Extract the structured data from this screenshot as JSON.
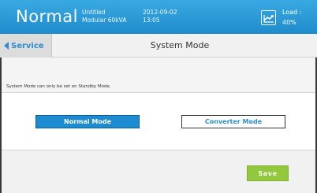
{
  "header": {
    "status": "Normal",
    "device_name": "Untitled",
    "device_model": "Modular 60kVA",
    "date": "2012-09-02",
    "time": "13:05",
    "load_label": "Load :",
    "load_value": "40%",
    "load_icon": "load-graph-icon"
  },
  "nav": {
    "back_label": "Service",
    "title": "System Mode"
  },
  "note": "System Mode can only be set on Standby Mode.",
  "modes": {
    "normal_label": "Normal Mode",
    "converter_label": "Converter Mode",
    "selected": "Normal Mode"
  },
  "actions": {
    "save_label": "Save"
  },
  "colors": {
    "header": "#2a9ad6",
    "accent": "#1d8bd2",
    "save": "#92c83e"
  }
}
